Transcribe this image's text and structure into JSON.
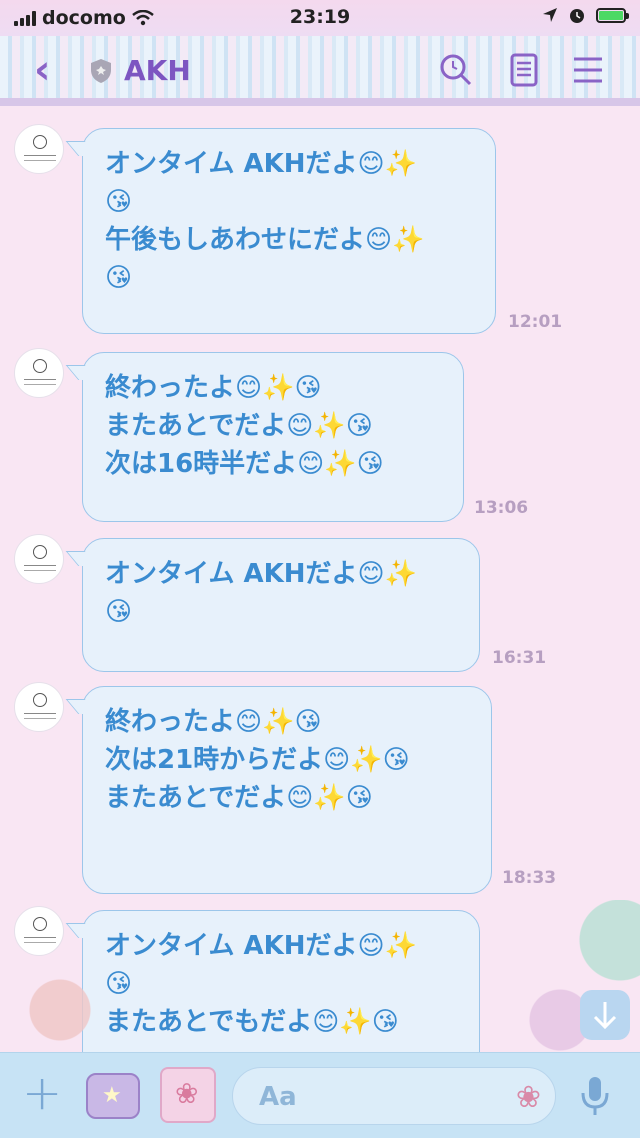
{
  "status_bar": {
    "carrier": "docomo",
    "time": "23:19"
  },
  "header": {
    "back_icon": "‹",
    "title": "AKH"
  },
  "messages": [
    {
      "lines": [
        "オンタイム AKHだよ😊✨",
        "😘",
        "午後もしあわせにだよ😊✨",
        "😘"
      ],
      "time": "12:01"
    },
    {
      "lines": [
        "終わったよ😊✨😘",
        "またあとでだよ😊✨😘",
        "次は16時半だよ😊✨😘"
      ],
      "time": "13:06"
    },
    {
      "lines": [
        "オンタイム AKHだよ😊✨",
        "😘"
      ],
      "time": "16:31"
    },
    {
      "lines": [
        "終わったよ😊✨😘",
        "次は21時からだよ😊✨😘",
        "またあとでだよ😊✨😘"
      ],
      "time": "18:33"
    },
    {
      "lines": [
        "オンタイム AKHだよ😊✨",
        "😘",
        "またあとでもだよ😊✨😘"
      ],
      "time": ""
    }
  ],
  "input": {
    "placeholder": "Aa"
  },
  "colors": {
    "accent": "#7d55c1",
    "bubble_text": "#3a8bd0"
  }
}
